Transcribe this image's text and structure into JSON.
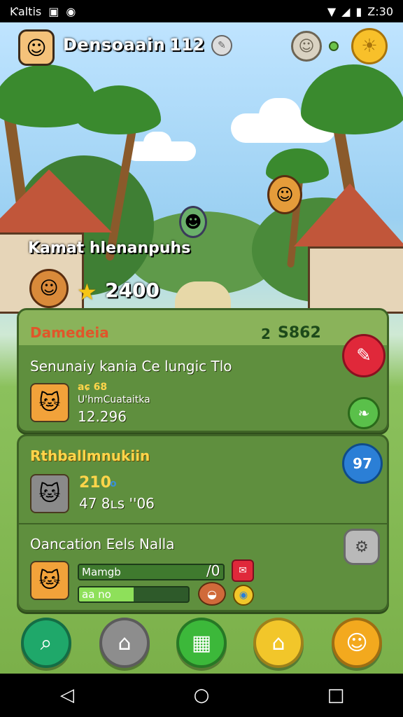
{
  "status_bar": {
    "left_text": "Ƙaltis",
    "time": "Z:30",
    "icons": [
      "image-icon",
      "record-icon",
      "wifi-icon",
      "signal-icon",
      "battery-icon"
    ]
  },
  "hud": {
    "player_name": "Densoaain",
    "player_level": "112",
    "avatar_icon": "player-avatar-icon",
    "chat_icon": "chat-bubble-icon",
    "friend_icon": "friend-face-icon",
    "sun_icon": "sun-icon"
  },
  "scene": {
    "location_label": "Kamat hlenanpuhs",
    "star_count": "2400"
  },
  "panel1": {
    "title": "Damedeia",
    "currency": "S862",
    "currency_prefix": "2",
    "subtitle": "Senunaiy kania Ce lungic Tlo",
    "pet_stat_a": "aɕ 68",
    "pet_stat_b": "U'hmCuataitka",
    "pet_value": "12.296"
  },
  "panel2": {
    "title": "Rthballmnukiin",
    "stat_top": "210",
    "stat_top_suffix": "o",
    "stat_bottom": "47 8ʟs ''06",
    "badge": "97"
  },
  "panel3": {
    "title": "Oancation Eels Nalla",
    "bar1_label": "Mamgb",
    "bar1_end": "/0",
    "bar1_progress": 1.0,
    "bar2_label": "aa no",
    "bar2_progress": 0.5
  },
  "bottom_nav": [
    {
      "name": "search",
      "icon": "magnifier-icon",
      "color": "#1fa86a"
    },
    {
      "name": "store",
      "icon": "store-icon",
      "color": "#8d8d8d"
    },
    {
      "name": "inventory",
      "icon": "grid-icon",
      "color": "#3cb83a"
    },
    {
      "name": "home",
      "icon": "home-icon",
      "color": "#f2c62a"
    },
    {
      "name": "profile",
      "icon": "face-icon",
      "color": "#f3a91e"
    }
  ],
  "colors": {
    "panel_bg": "#5f8f3e",
    "title_gold": "#ffd54a",
    "pencil_red": "#e0283a",
    "badge_blue": "#2b7fd6"
  }
}
